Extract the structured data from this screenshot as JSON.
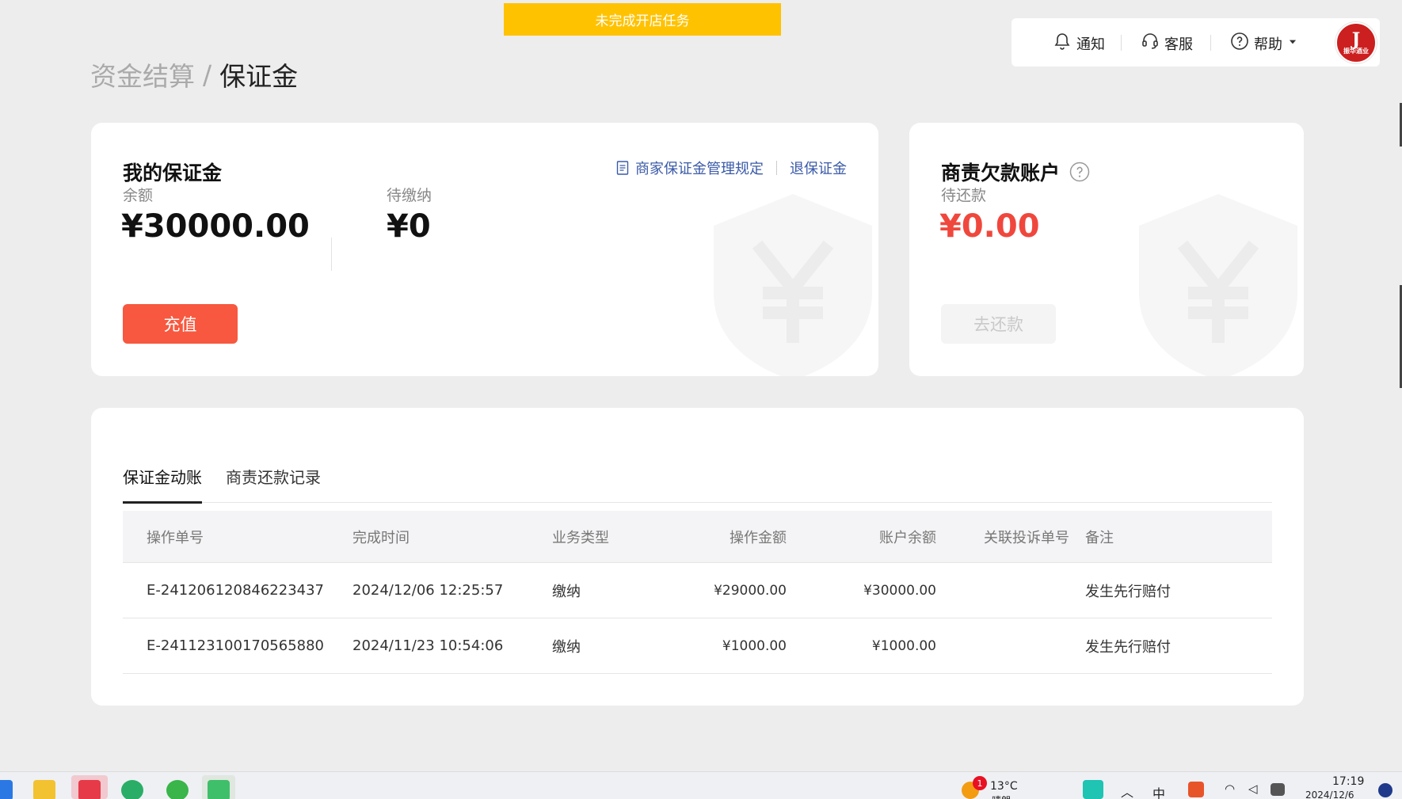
{
  "banner": {
    "text": "未完成开店任务"
  },
  "topbar": {
    "notify_label": "通知",
    "service_label": "客服",
    "help_label": "帮助",
    "avatar_letter": "J",
    "avatar_sub": "振华酒业"
  },
  "breadcrumb": {
    "parent": "资金结算",
    "separator": "/",
    "current": "保证金"
  },
  "deposit": {
    "title": "我的保证金",
    "rules_link": "商家保证金管理规定",
    "refund_link": "退保证金",
    "balance_label": "余额",
    "balance_value": "¥30000.00",
    "pending_label": "待缴纳",
    "pending_value": "¥0",
    "recharge_button": "充值"
  },
  "debt": {
    "title": "商责欠款账户",
    "due_label": "待还款",
    "due_value": "¥0.00",
    "repay_button": "去还款"
  },
  "tabs": [
    {
      "label": "保证金动账",
      "active": true
    },
    {
      "label": "商责还款记录",
      "active": false
    }
  ],
  "table": {
    "headers": [
      "操作单号",
      "完成时间",
      "业务类型",
      "操作金额",
      "账户余额",
      "关联投诉单号",
      "备注"
    ],
    "rows": [
      [
        "E-241206120846223437",
        "2024/12/06 12:25:57",
        "缴纳",
        "¥29000.00",
        "¥30000.00",
        "",
        "发生先行赔付"
      ],
      [
        "E-241123100170565880",
        "2024/11/23 10:54:06",
        "缴纳",
        "¥1000.00",
        "¥1000.00",
        "",
        "发生先行赔付"
      ]
    ]
  },
  "taskbar": {
    "badge_count": "1",
    "weather_temp": "13°C",
    "weather_desc": "晴朗",
    "ime": "中",
    "time": "17:19",
    "date": "2024/12/6"
  },
  "colors": {
    "banner": "#ffc200",
    "primary_button": "#f7583f",
    "amount_red": "#f0473d",
    "link_blue": "#3a5aa8"
  }
}
